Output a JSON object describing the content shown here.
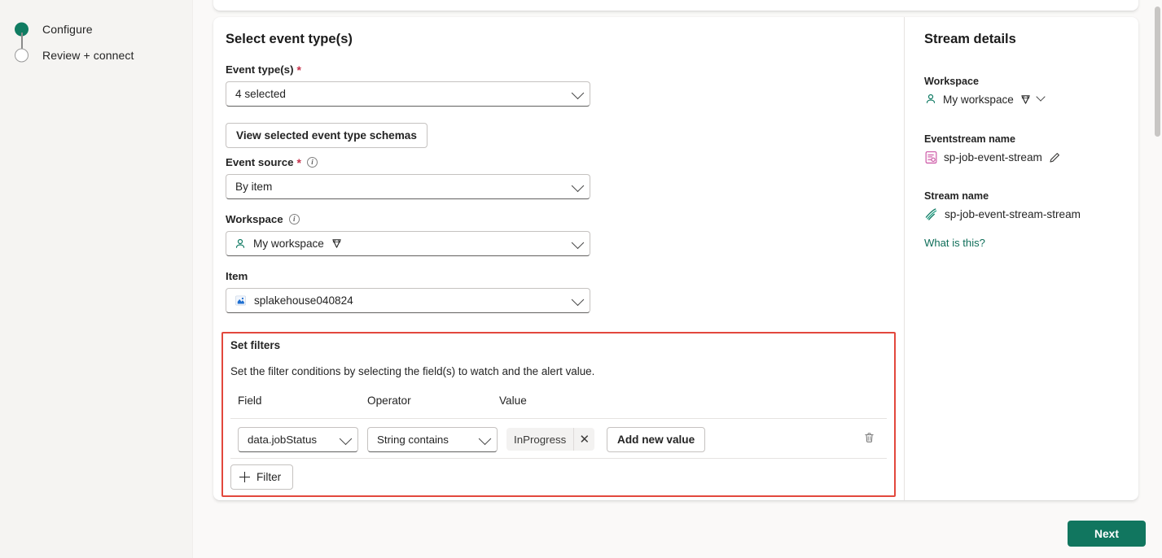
{
  "wizard": {
    "steps": [
      {
        "label": "Configure",
        "state": "done"
      },
      {
        "label": "Review + connect",
        "state": "todo"
      }
    ]
  },
  "form": {
    "section_title": "Select event type(s)",
    "event_types": {
      "label": "Event type(s)",
      "required_marker": "*",
      "value": "4 selected"
    },
    "view_schemas_button": "View selected event type schemas",
    "event_source": {
      "label": "Event source",
      "required_marker": "*",
      "value": "By item"
    },
    "workspace": {
      "label": "Workspace",
      "value": "My workspace",
      "icons": [
        "person-icon",
        "diamond-icon"
      ]
    },
    "item": {
      "label": "Item",
      "value": "splakehouse040824",
      "icon": "lakehouse-icon"
    }
  },
  "filters": {
    "title": "Set filters",
    "description": "Set the filter conditions by selecting the field(s) to watch and the alert value.",
    "columns": [
      "Field",
      "Operator",
      "Value"
    ],
    "rows": [
      {
        "field": "data.jobStatus",
        "operator": "String contains",
        "value_tag": "InProgress",
        "add_value_button": "Add new value"
      }
    ],
    "add_filter_button": "Filter",
    "highlight_color": "#e2483d"
  },
  "details": {
    "title": "Stream details",
    "workspace_label": "Workspace",
    "workspace_value": "My workspace",
    "eventstream_label": "Eventstream name",
    "eventstream_value": "sp-job-event-stream",
    "stream_label": "Stream name",
    "stream_value": "sp-job-event-stream-stream",
    "help_link": "What is this?"
  },
  "footer": {
    "next_button": "Next",
    "accent_color": "#11765f"
  }
}
